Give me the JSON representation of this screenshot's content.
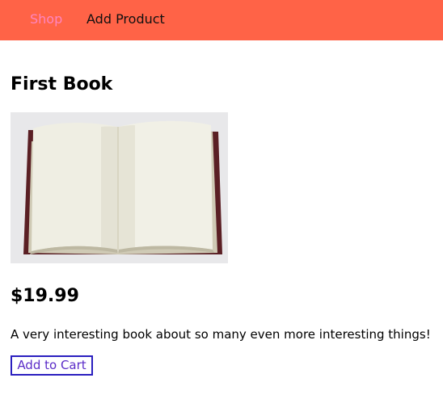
{
  "header": {
    "nav": [
      {
        "label": "Shop",
        "active": true
      },
      {
        "label": "Add Product",
        "active": false
      }
    ],
    "background": "#ff6347",
    "active_color": "#ff85c0"
  },
  "product": {
    "title": "First Book",
    "image_icon": "open-book-image",
    "price": "$19.99",
    "description": "A very interesting book about so many even more interesting things!",
    "add_to_cart_label": "Add to Cart"
  }
}
